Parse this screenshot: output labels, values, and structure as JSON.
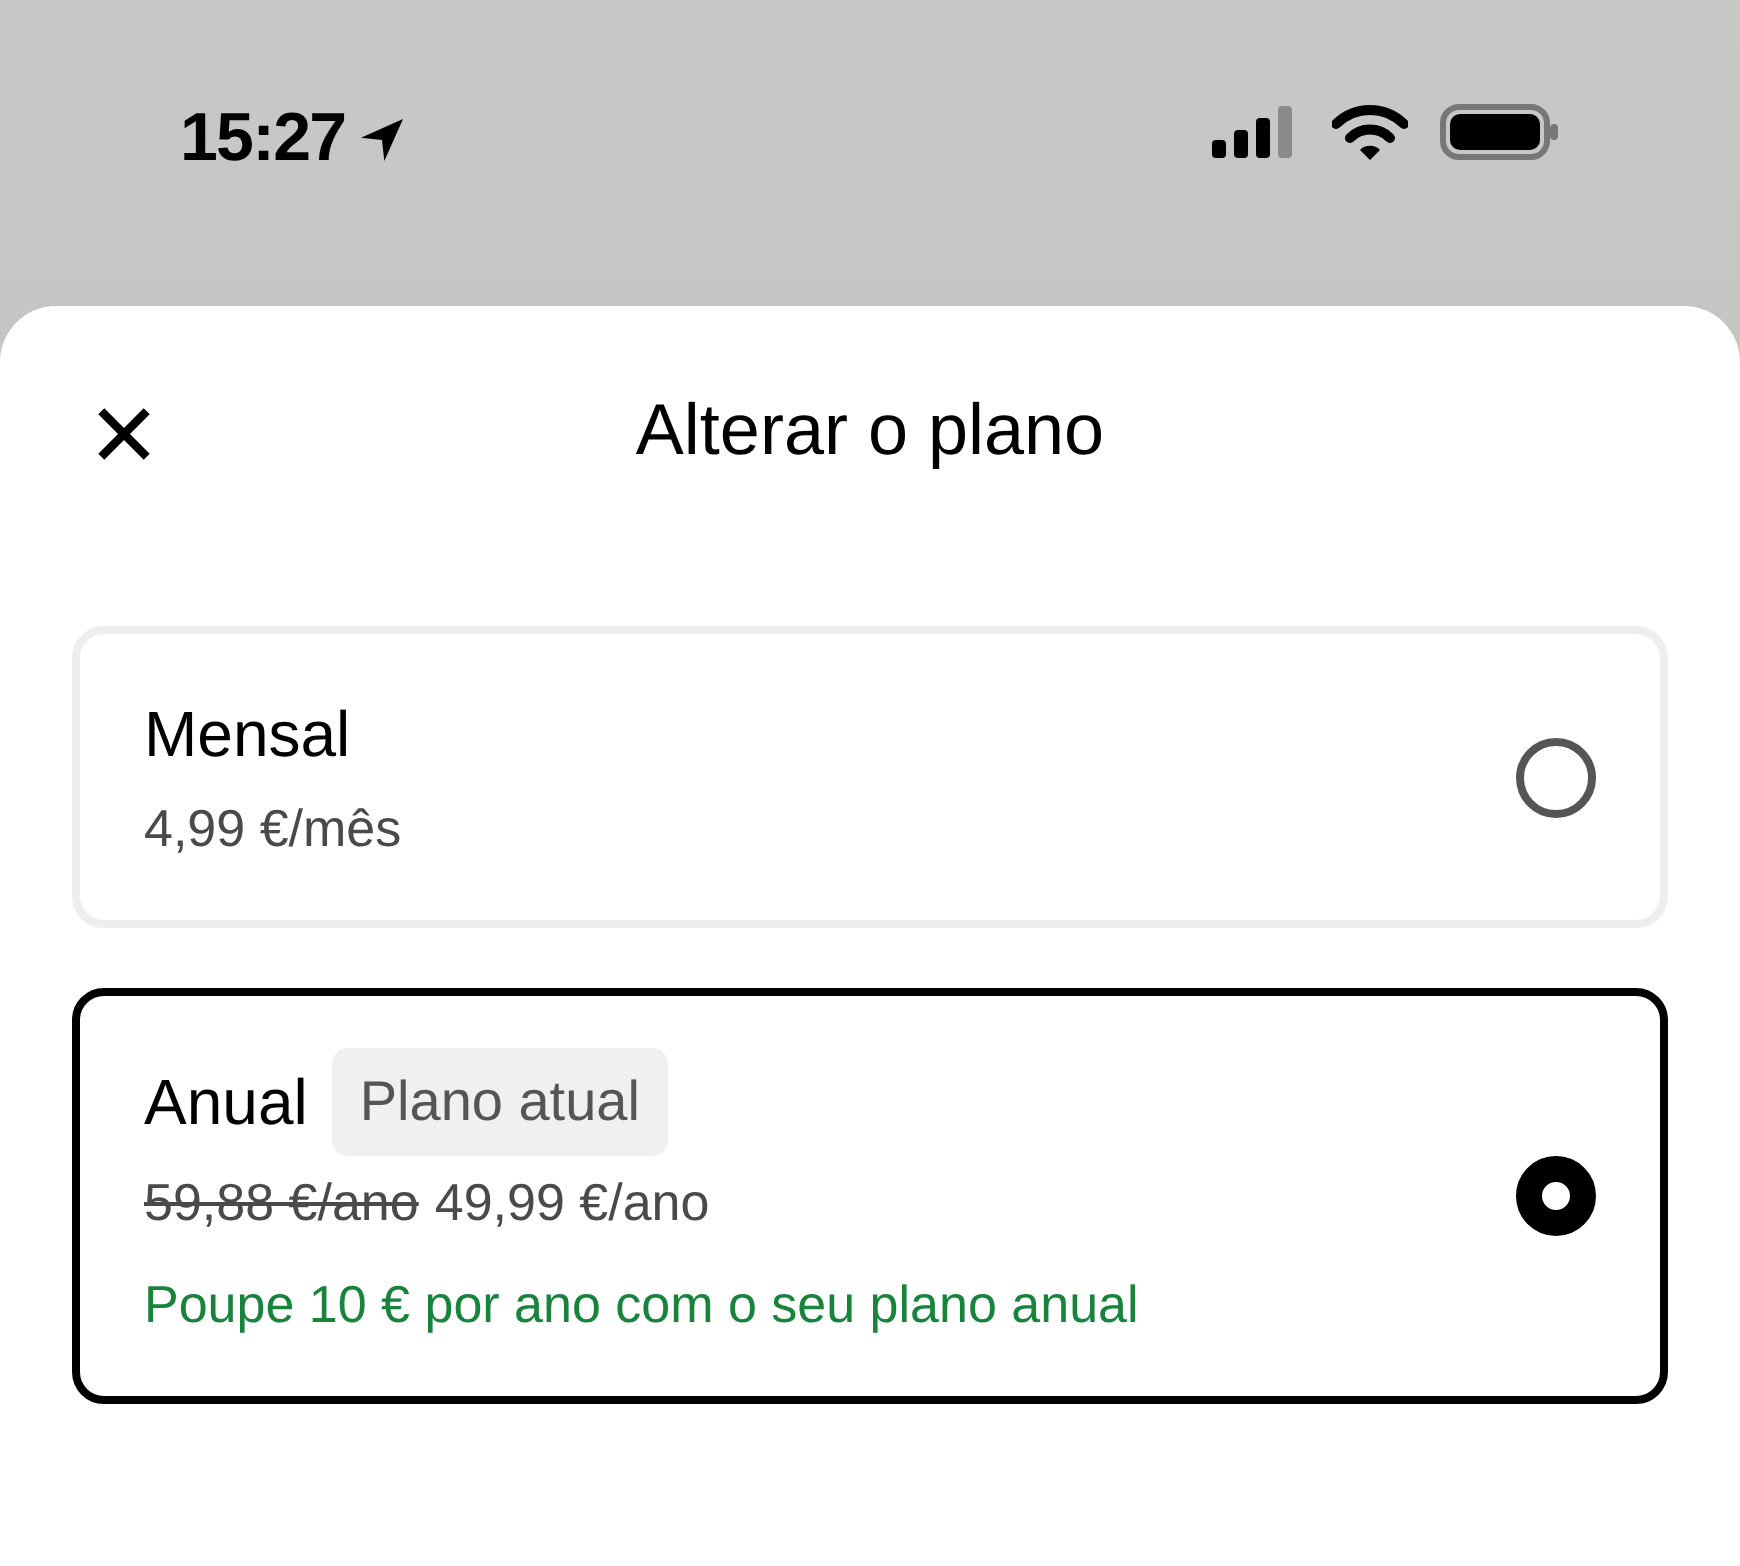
{
  "status_bar": {
    "time": "15:27"
  },
  "sheet": {
    "title": "Alterar o plano"
  },
  "plans": [
    {
      "name": "Mensal",
      "price": "4,99 €/mês",
      "selected": false
    },
    {
      "name": "Anual",
      "badge": "Plano atual",
      "old_price": "59,88 €/ano",
      "price": "49,99 €/ano",
      "savings": "Poupe 10 € por ano com o seu plano anual",
      "selected": true
    }
  ]
}
